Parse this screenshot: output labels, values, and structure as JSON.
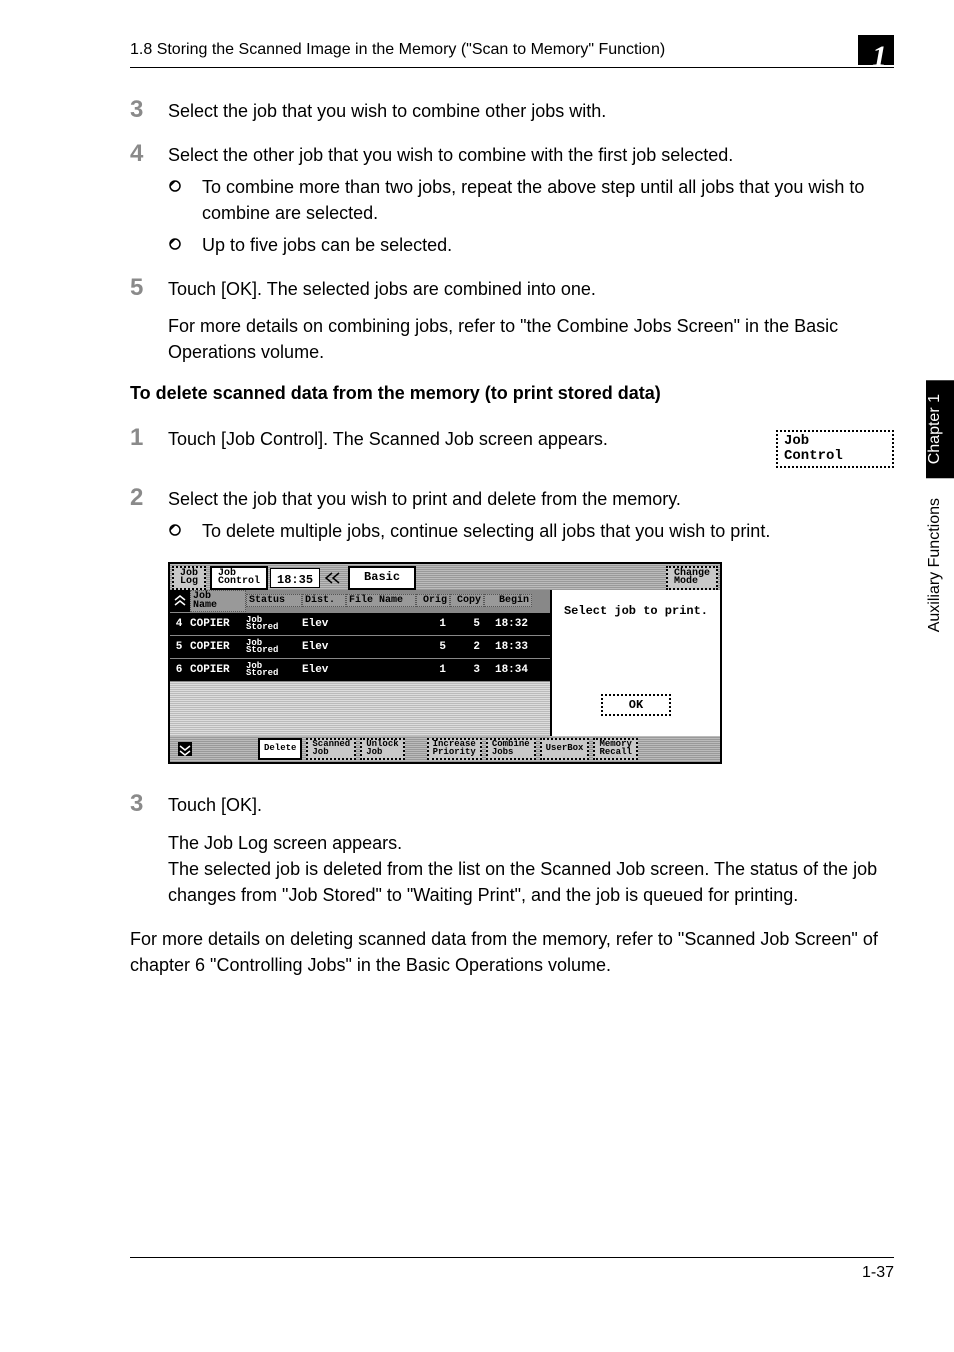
{
  "header": {
    "title": "1.8 Storing the Scanned Image in the Memory (\"Scan to Memory\" Function)",
    "chapter_number": "1"
  },
  "steps_a": [
    {
      "num": "3",
      "text": "Select the job that you wish to combine other jobs with."
    },
    {
      "num": "4",
      "text": "Select the other job that you wish to combine with the first job selected.",
      "subs": [
        "To combine more than two jobs, repeat the above step until all jobs that you wish to combine are selected.",
        "Up to five jobs can be selected."
      ]
    },
    {
      "num": "5",
      "text": "Touch [OK]. The selected jobs are combined into one.",
      "after": "For more details on combining jobs, refer to \"the Combine Jobs Screen\" in the Basic Operations volume."
    }
  ],
  "section_heading": "To delete scanned data from the memory (to print stored data)",
  "job_control_btn": {
    "line1": "Job",
    "line2": "Control"
  },
  "steps_b": [
    {
      "num": "1",
      "text": "Touch [Job Control]. The Scanned Job screen appears."
    },
    {
      "num": "2",
      "text": "Select the job that you wish to print and delete from the memory.",
      "subs": [
        "To delete multiple jobs, continue selecting all jobs that you wish to print."
      ]
    }
  ],
  "screen": {
    "tabs": {
      "log": "Job\nLog",
      "control": "Job\nControl",
      "basic": "Basic",
      "change": "Change\nMode"
    },
    "time": "18:35",
    "headers": [
      "#",
      "Job\nName",
      "Status",
      "Dist.",
      "File Name",
      "Orig",
      "Copy",
      "Begin"
    ],
    "rows": [
      {
        "idx": "4",
        "name": "COPIER",
        "status": "Job\nStored",
        "dist": "Elev",
        "file": "",
        "orig": "1",
        "copy": "5",
        "begin": "18:32"
      },
      {
        "idx": "5",
        "name": "COPIER",
        "status": "Job\nStored",
        "dist": "Elev",
        "file": "",
        "orig": "5",
        "copy": "2",
        "begin": "18:33"
      },
      {
        "idx": "6",
        "name": "COPIER",
        "status": "Job\nStored",
        "dist": "Elev",
        "file": "",
        "orig": "1",
        "copy": "3",
        "begin": "18:34"
      }
    ],
    "side_msg": "Select job to print.",
    "ok": "OK",
    "bottom": [
      "Delete",
      "Scanned\nJob",
      "Unlock\nJob",
      "Increase\nPriority",
      "Combine\nJobs",
      "UserBox",
      "Memory\nRecall"
    ]
  },
  "steps_c": {
    "num": "3",
    "text": "Touch [OK].",
    "after": "The Job Log screen appears.\nThe selected job is deleted from the list on the Scanned Job screen. The status of the job changes from \"Job Stored\" to \"Waiting Print\", and the job is queued for printing."
  },
  "closing": "For more details on deleting scanned data from the memory, refer to \"Scanned Job Screen\" of chapter 6 \"Controlling Jobs\" in the Basic Operations volume.",
  "side": {
    "chapter": "Chapter 1",
    "section": "Auxiliary Functions"
  },
  "page_number": "1-37"
}
